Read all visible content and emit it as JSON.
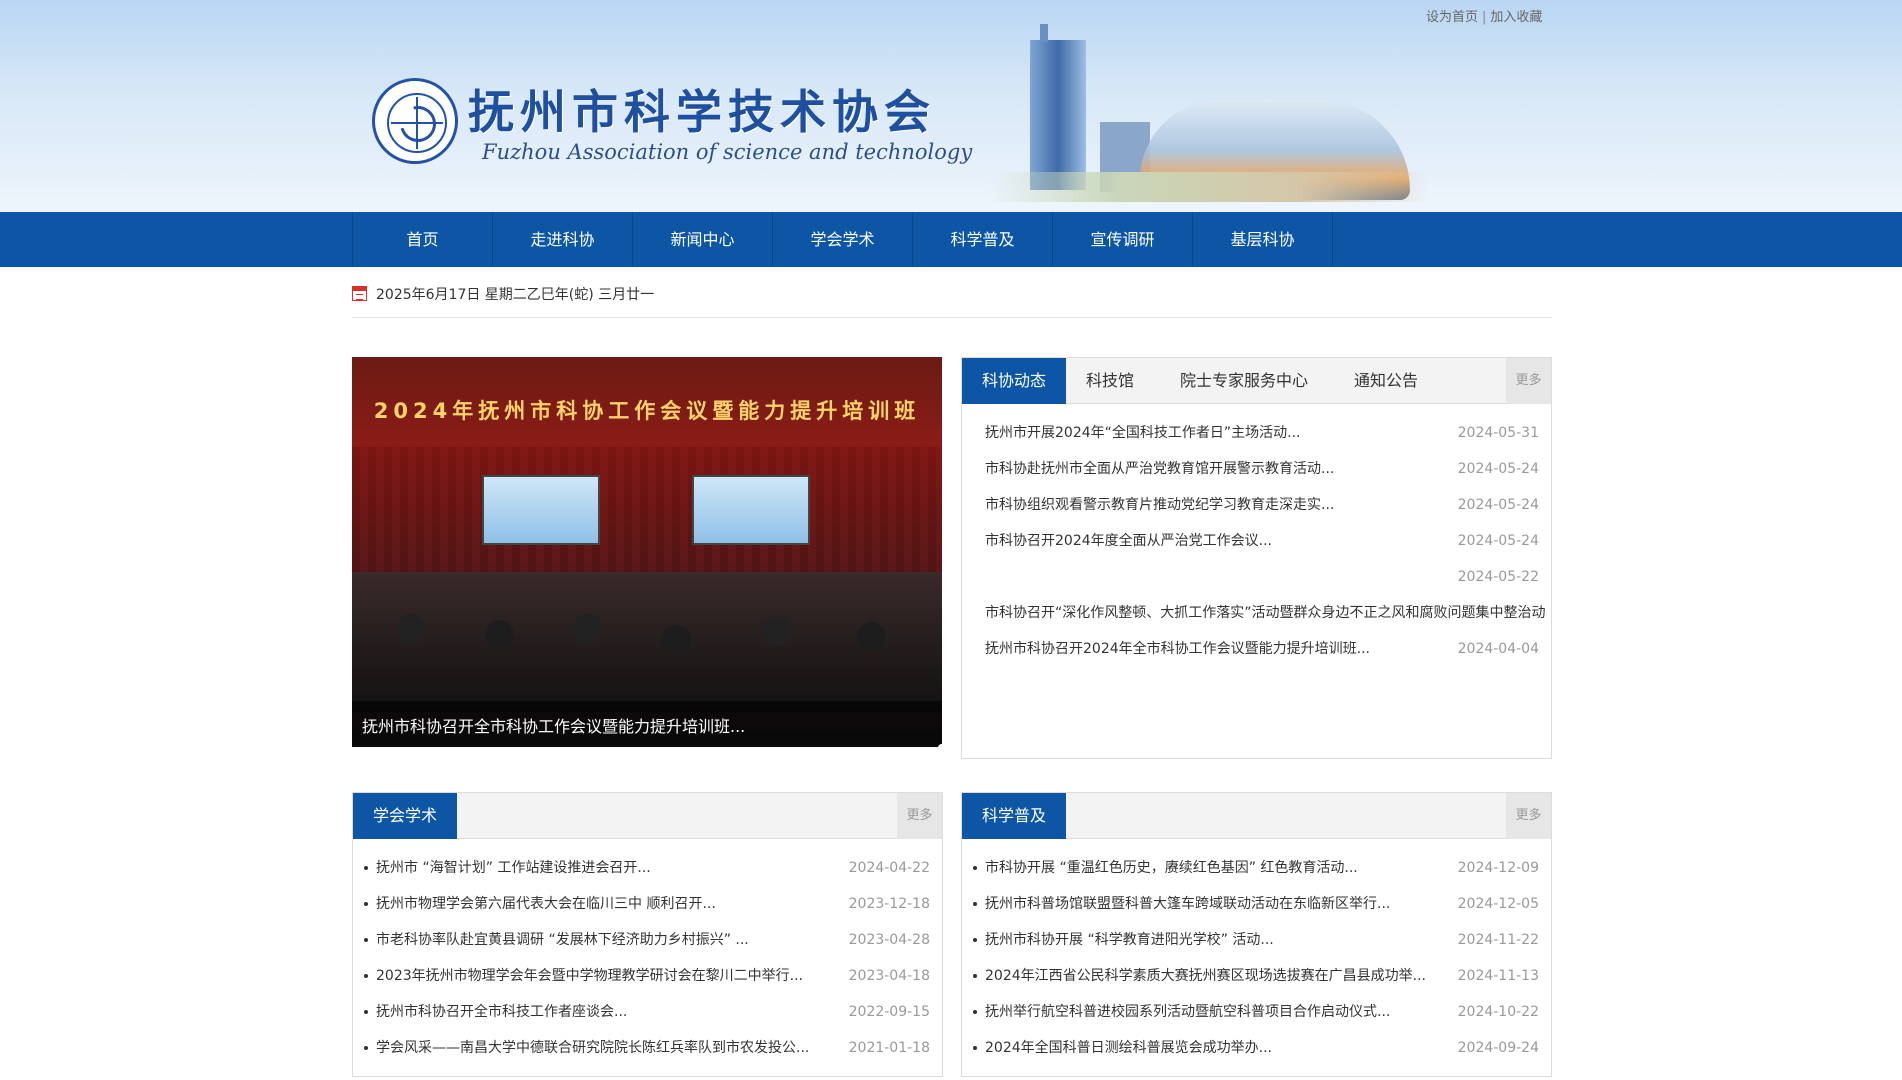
{
  "top_links": {
    "set_home": "设为首页",
    "separator": "|",
    "bookmark": "加入收藏"
  },
  "site": {
    "title": "抚州市科学技术协会",
    "subtitle": "Fuzhou Association of science and technology"
  },
  "nav": {
    "items": [
      {
        "label": "首页"
      },
      {
        "label": "走进科协"
      },
      {
        "label": "新闻中心"
      },
      {
        "label": "学会学术"
      },
      {
        "label": "科学普及"
      },
      {
        "label": "宣传调研"
      },
      {
        "label": "基层科协"
      }
    ]
  },
  "date_text": "2025年6月17日 星期二乙巳年(蛇) 三月廿一",
  "slider": {
    "banner_text": "2024年抚州市科协工作会议暨能力提升培训班",
    "caption": "抚州市科协召开全市科协工作会议暨能力提升培训班...",
    "dot_count": 4,
    "active_dot": 4
  },
  "news_tabs": {
    "tabs": [
      {
        "label": "科协动态"
      },
      {
        "label": "科技馆"
      },
      {
        "label": "院士专家服务中心"
      },
      {
        "label": "通知公告"
      }
    ],
    "more": "更多",
    "items": [
      {
        "title": "抚州市开展2024年“全国科技工作者日”主场活动...",
        "date": "2024-05-31"
      },
      {
        "title": "市科协赴抚州市全面从严治党教育馆开展警示教育活动...",
        "date": "2024-05-24"
      },
      {
        "title": "市科协组织观看警示教育片推动党纪学习教育走深走实...",
        "date": "2024-05-24"
      },
      {
        "title": "市科协召开2024年度全面从严治党工作会议...",
        "date": "2024-05-24"
      },
      {
        "title": "",
        "date": "2024-05-22"
      },
      {
        "title": "市科协召开“深化作风整顿、大抓工作落实”活动暨群众身边不正之风和腐败问题集中整治动",
        "date": ""
      },
      {
        "title": "抚州市科协召开2024年全市科协工作会议暨能力提升培训班...",
        "date": "2024-04-04"
      }
    ]
  },
  "box_academic": {
    "title": "学会学术",
    "more": "更多",
    "items": [
      {
        "title": "抚州市 “海智计划” 工作站建设推进会召开...",
        "date": "2024-04-22"
      },
      {
        "title": "抚州市物理学会第六届代表大会在临川三中 顺利召开...",
        "date": "2023-12-18"
      },
      {
        "title": "市老科协率队赴宜黄县调研 “发展林下经济助力乡村振兴” ...",
        "date": "2023-04-28"
      },
      {
        "title": "2023年抚州市物理学会年会暨中学物理教学研讨会在黎川二中举行...",
        "date": "2023-04-18"
      },
      {
        "title": "抚州市科协召开全市科技工作者座谈会...",
        "date": "2022-09-15"
      },
      {
        "title": "学会风采——南昌大学中德联合研究院院长陈红兵率队到市农发投公...",
        "date": "2021-01-18"
      }
    ]
  },
  "box_popular": {
    "title": "科学普及",
    "more": "更多",
    "items": [
      {
        "title": "市科协开展 “重温红色历史，赓续红色基因” 红色教育活动...",
        "date": "2024-12-09"
      },
      {
        "title": "抚州市科普场馆联盟暨科普大篷车跨域联动活动在东临新区举行...",
        "date": "2024-12-05"
      },
      {
        "title": "抚州市科协开展 “科学教育进阳光学校” 活动...",
        "date": "2024-11-22"
      },
      {
        "title": "2024年江西省公民科学素质大赛抚州赛区现场选拔赛在广昌县成功举...",
        "date": "2024-11-13"
      },
      {
        "title": "抚州举行航空科普进校园系列活动暨航空科普项目合作启动仪式...",
        "date": "2024-10-22"
      },
      {
        "title": "2024年全国科普日测绘科普展览会成功举办...",
        "date": "2024-09-24"
      }
    ]
  }
}
